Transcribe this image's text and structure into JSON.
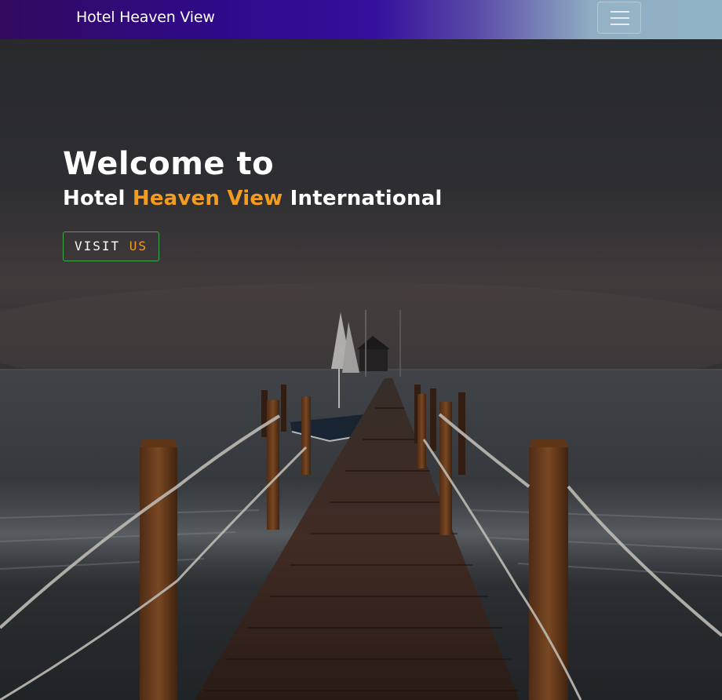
{
  "navbar": {
    "brand": "Hotel Heaven View",
    "toggler_icon": "hamburger-menu-icon"
  },
  "hero": {
    "welcome": "Welcome to",
    "subtitle_part1": "Hotel",
    "subtitle_highlight": "Heaven View",
    "subtitle_part2": "International",
    "button_part1": "VISIT",
    "button_highlight": "US",
    "background": "pier-at-dusk-image"
  },
  "colors": {
    "accent": "#f39c1f",
    "button_border": "#3fa84a",
    "navbar_start": "#33095e",
    "navbar_end": "#90b3c6"
  }
}
